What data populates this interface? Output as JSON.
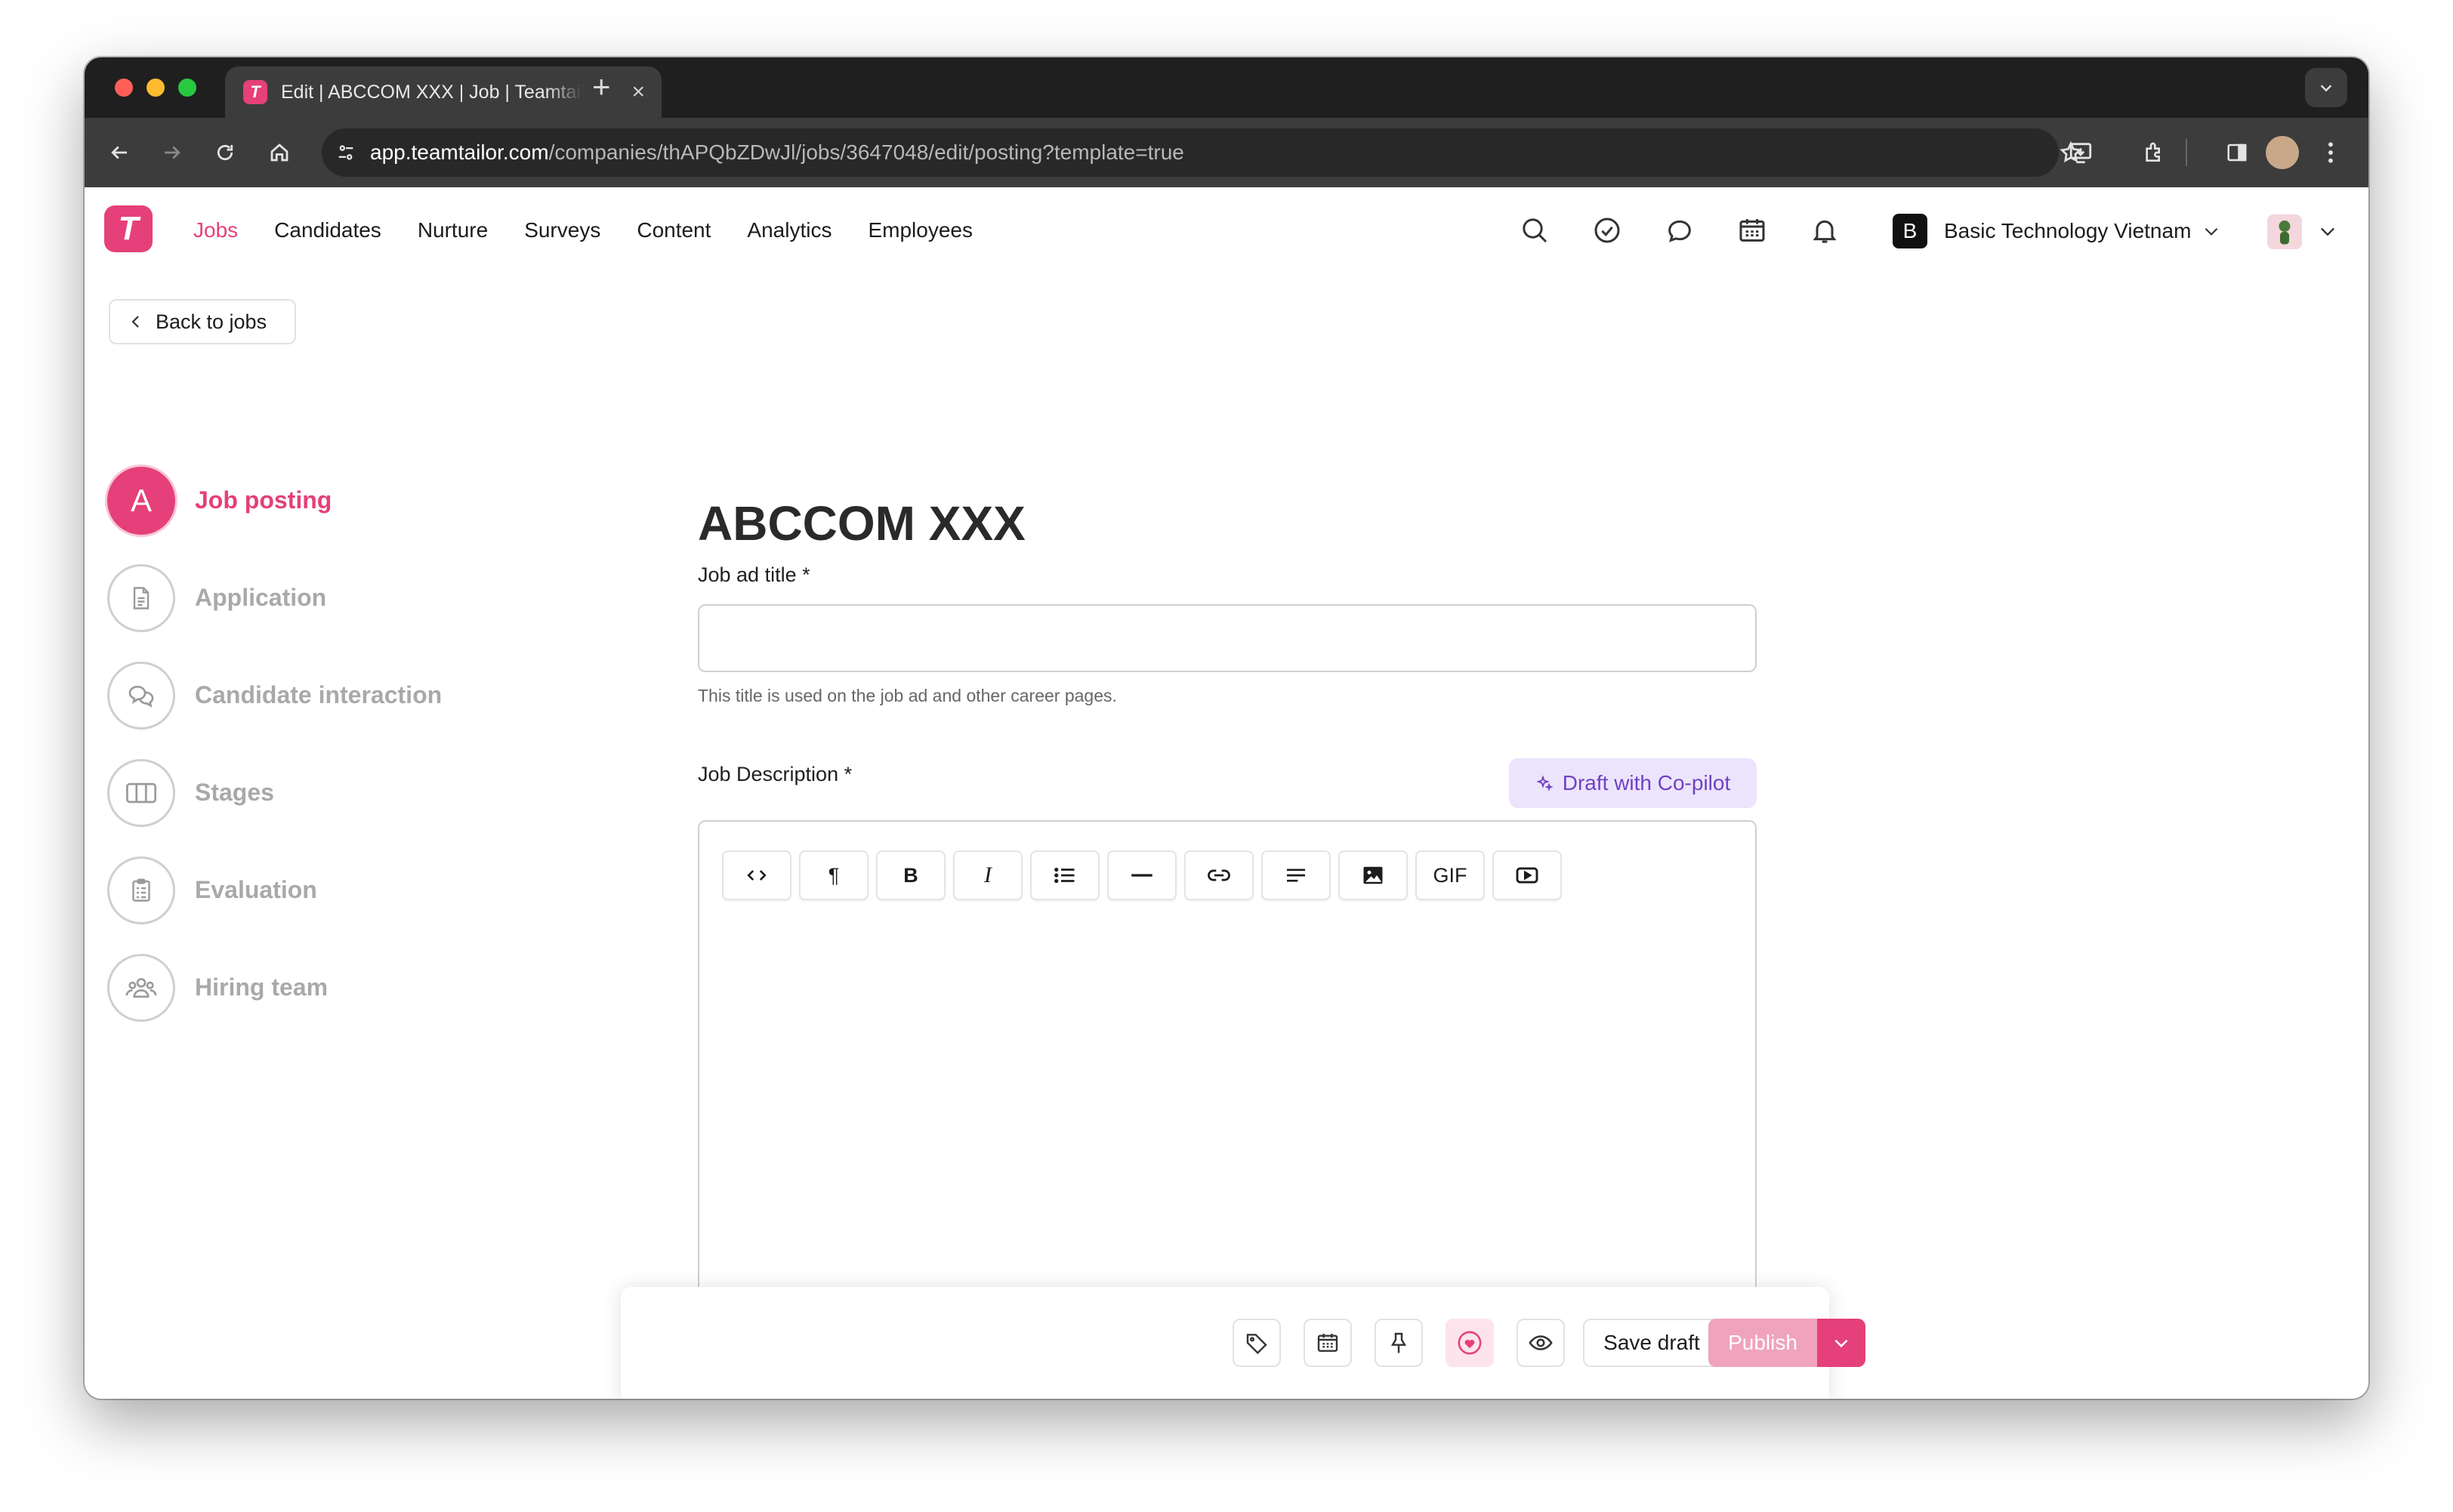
{
  "browser": {
    "tab_title": "Edit | ABCCOM XXX | Job | Teamtailor",
    "tab_favicon": "T",
    "url_host": "app.teamtailor.com",
    "url_path": "/companies/thAPQbZDwJl/jobs/3647048/edit/posting?template=true"
  },
  "app": {
    "logo": "T",
    "nav": [
      {
        "label": "Jobs",
        "active": true
      },
      {
        "label": "Candidates"
      },
      {
        "label": "Nurture"
      },
      {
        "label": "Surveys"
      },
      {
        "label": "Content"
      },
      {
        "label": "Analytics"
      },
      {
        "label": "Employees"
      }
    ],
    "header_icons": [
      "search-icon",
      "check-circle-icon",
      "chat-icon",
      "calendar-icon",
      "bell-icon"
    ],
    "company_badge": "B",
    "company_name": "Basic Technology Vietnam",
    "accent": "#e5407a"
  },
  "back_label": "Back to jobs",
  "steps": [
    {
      "label": "Job posting",
      "badge": "A",
      "active": true,
      "icon": "letter-a"
    },
    {
      "label": "Application",
      "icon": "document-icon"
    },
    {
      "label": "Candidate interaction",
      "icon": "chat-bubbles-icon"
    },
    {
      "label": "Stages",
      "icon": "columns-icon"
    },
    {
      "label": "Evaluation",
      "icon": "clipboard-icon"
    },
    {
      "label": "Hiring team",
      "icon": "team-icon"
    }
  ],
  "form": {
    "heading": "ABCCOM XXX",
    "title_label": "Job ad title *",
    "title_value": "",
    "title_hint": "This title is used on the job ad and other career pages.",
    "description_label": "Job Description *",
    "copilot_label": "Draft with Co-pilot",
    "editor_tools": [
      {
        "name": "code-icon",
        "glyph": "<>"
      },
      {
        "name": "paragraph-icon",
        "glyph": "¶"
      },
      {
        "name": "bold-button",
        "glyph": "B"
      },
      {
        "name": "italic-button",
        "glyph": "I"
      },
      {
        "name": "bullet-list-icon"
      },
      {
        "name": "horizontal-rule-icon"
      },
      {
        "name": "link-icon"
      },
      {
        "name": "align-icon"
      },
      {
        "name": "image-icon"
      },
      {
        "name": "gif-button",
        "glyph": "GIF"
      },
      {
        "name": "video-icon"
      }
    ]
  },
  "actions": {
    "icons": [
      "tag-icon",
      "calendar-icon",
      "pin-icon",
      "heart-icon",
      "eye-icon"
    ],
    "save_draft": "Save draft",
    "publish": "Publish"
  }
}
